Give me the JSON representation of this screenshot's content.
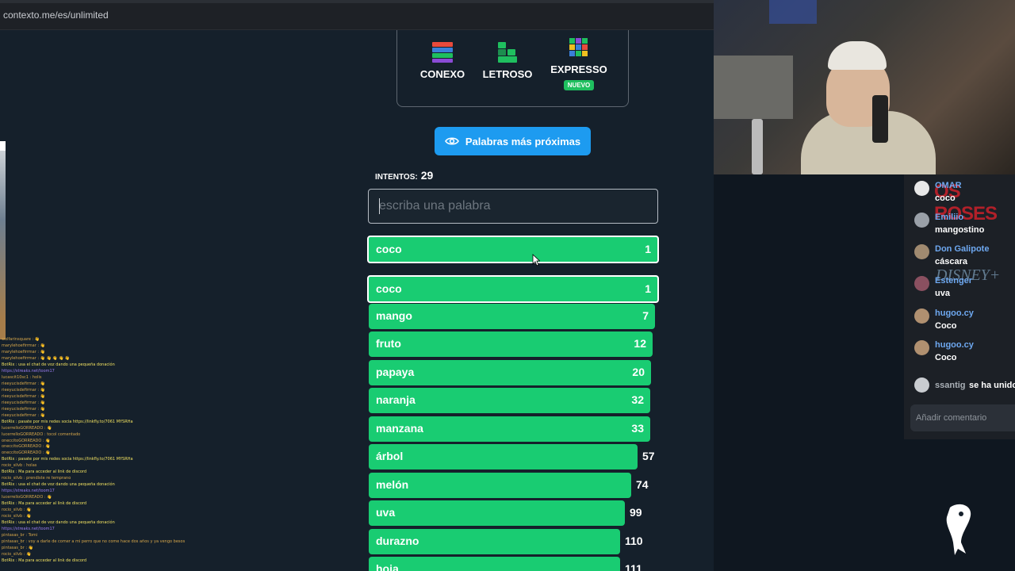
{
  "browser": {
    "url": "contexto.me/es/unlimited"
  },
  "games": [
    {
      "label": "CONEXO",
      "icon": "conexo-icon"
    },
    {
      "label": "LETROSO",
      "icon": "letroso-icon"
    },
    {
      "label": "EXPRESSO",
      "icon": "expresso-icon",
      "badge": "NUEVO"
    }
  ],
  "near_button": {
    "label": "Palabras más próximas",
    "icon": "eye-icon"
  },
  "attempts": {
    "label": "INTENTOS:",
    "count": "29"
  },
  "input": {
    "placeholder": "escriba una palabra",
    "value": ""
  },
  "last_guess": {
    "word": "coco",
    "rank": "1"
  },
  "guesses": [
    {
      "word": "coco",
      "rank": "1"
    },
    {
      "word": "mango",
      "rank": "7"
    },
    {
      "word": "fruto",
      "rank": "12"
    },
    {
      "word": "papaya",
      "rank": "20"
    },
    {
      "word": "naranja",
      "rank": "32"
    },
    {
      "word": "manzana",
      "rank": "33"
    },
    {
      "word": "árbol",
      "rank": "57"
    },
    {
      "word": "melón",
      "rank": "74"
    },
    {
      "word": "uva",
      "rank": "99"
    },
    {
      "word": "durazno",
      "rank": "110"
    },
    {
      "word": "hoja",
      "rank": "111"
    }
  ],
  "right_chat": {
    "messages": [
      {
        "user": "OMAR",
        "text": "coco",
        "avatar_color": "#e8e8e8"
      },
      {
        "user": "Emiliio",
        "text": "mangostino",
        "avatar_color": "#9aa0a8"
      },
      {
        "user": "Don Galipote",
        "text": "cáscara",
        "avatar_color": "#a08a70"
      },
      {
        "user": "Estenger",
        "text": "uva",
        "avatar_color": "#8a5060"
      },
      {
        "user": "hugoo.cy",
        "text": "Coco",
        "avatar_color": "#b09070"
      },
      {
        "user": "hugoo.cy",
        "text": "Coco",
        "avatar_color": "#b09070"
      }
    ],
    "join": {
      "user": "ssantig",
      "text": "se ha unido"
    },
    "comment_placeholder": "Añadir comentario",
    "background_text": "OS ROSES",
    "background_text2": "DISNEY+"
  },
  "left_chat_lines": [
    "wolfarinsquare : 👋",
    "marylehoefirrmar : 👋",
    "marylehoefirrmar : 👋",
    "marylehoefirrmar : 👋 👋 👋 👋 👋",
    "BotRix : usa el chat de voz dando una pequeña donación",
    "https://streaks.net/toom17",
    "lucascit10sc1 : holis",
    "rieeyucisdefirmar : 👋",
    "rieeyucisdefirmar : 👋",
    "rieeyucisdefirmar : 👋",
    "rieeyucisdefirmar : 👋",
    "rieeyucisdefirmar : 👋",
    "rieeyucisdefirmar : 👋",
    "BotRix : pasate por mis redes socia https://linkfly.to/7061 MYSRHa",
    "lucerrelloGORREADO : 👋",
    "lucerrelloGORREADO : tocol comentado",
    "oneccitoGORREADO : 👋",
    "oneccitoGORREADO : 👋",
    "oneccitoGORREADO : 👋",
    "BotRix : pasate por mis redes socia https://linkfly.to/7061 MYSRHa",
    "rocio_silvb : holas",
    "BotRix : Ma para acceder al link de discord",
    "rocio_silvb : prendiste re temprano",
    "BotRix : usa el chat de voz dando una pequeña donación",
    "https://streaks.net/toom17",
    "lucerrelloGORREADO : 👋",
    "BotRix : Ma para acceder al link de discord",
    "rocio_silvb : 👋",
    "rocio_silvb : 👋",
    "BotRix : usa el chat de voz dando una pequeña donación",
    "https://streaks.net/toom17",
    "pintasas_br : Tomi",
    "pintasas_br : voy a darle de comer a mi perro que no come hace dos años y ya vengo besos",
    "pintasas_br : 👋",
    "rocio_silvb : 👋",
    "BotRix : Ma para acceder al link de discord"
  ],
  "colors": {
    "row_green": "#19cc72",
    "accent_blue": "#1d9bf0",
    "bg": "#15202b",
    "badge_green": "#1fbf5f"
  }
}
